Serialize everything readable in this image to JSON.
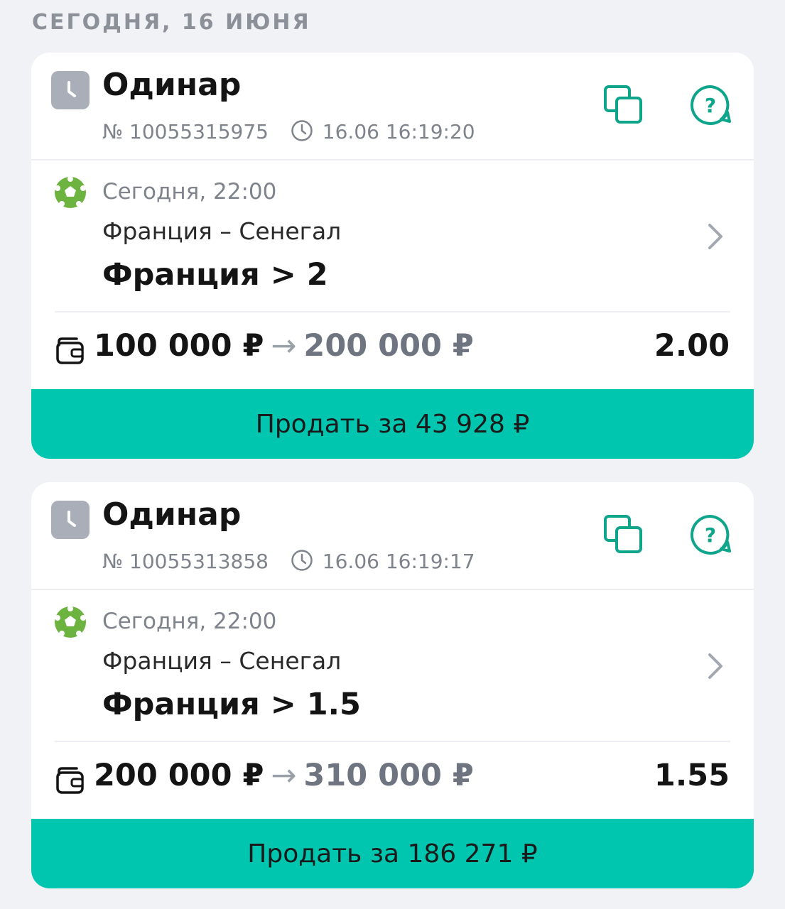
{
  "date_header": "Сегодня, 16 июня",
  "colors": {
    "accent": "#00c6b0",
    "icon_green": "#0fa58b",
    "ball_green": "#6db33f",
    "badge_gray": "#a9aeb8"
  },
  "bets": [
    {
      "type": "Одинар",
      "number": "№ 10055315975",
      "placed_at": "16.06 16:19:20",
      "event_time": "Сегодня, 22:00",
      "teams": "Франция – Сенегал",
      "selection": "Франция > 2",
      "stake": "100 000 ₽",
      "payout": "200 000 ₽",
      "odds": "2.00",
      "sell_label": "Продать за 43 928 ₽"
    },
    {
      "type": "Одинар",
      "number": "№ 10055313858",
      "placed_at": "16.06 16:19:17",
      "event_time": "Сегодня, 22:00",
      "teams": "Франция – Сенегал",
      "selection": "Франция > 1.5",
      "stake": "200 000 ₽",
      "payout": "310 000 ₽",
      "odds": "1.55",
      "sell_label": "Продать за 186 271 ₽"
    }
  ]
}
